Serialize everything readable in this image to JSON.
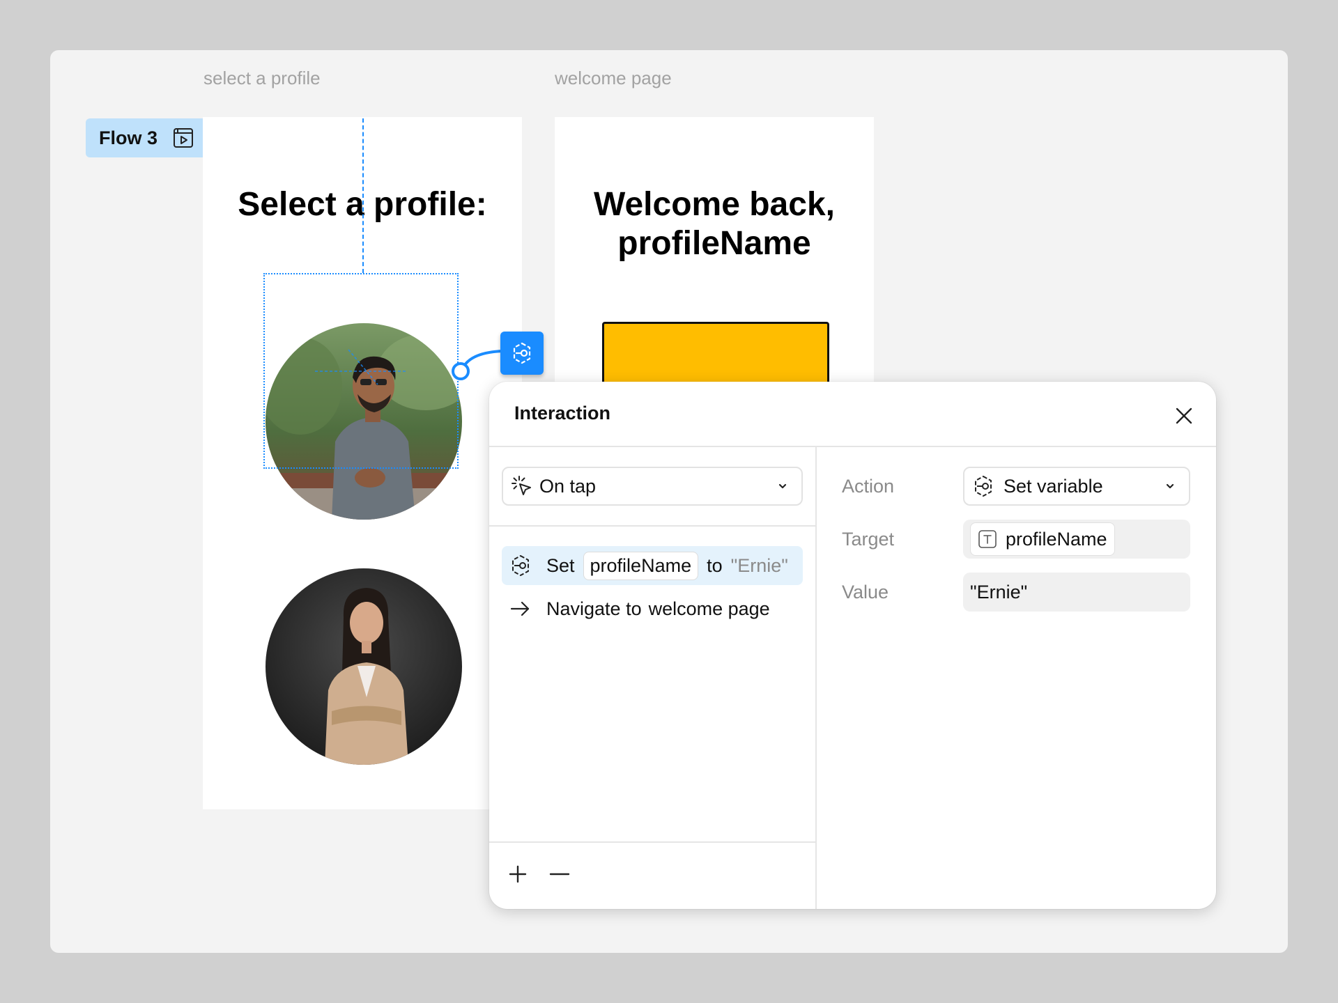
{
  "canvas": {
    "frames": [
      {
        "label": "select a profile",
        "heading": "Select a profile:"
      },
      {
        "label": "welcome page",
        "heading_line1": "Welcome back,",
        "heading_line2": "profileName"
      }
    ],
    "flow_badge": {
      "label": "Flow 3",
      "icon": "flow-play-icon"
    },
    "button_color": "#ffbd00",
    "accent_color": "#1a8cff"
  },
  "panel": {
    "title": "Interaction",
    "close_icon": "close-icon",
    "trigger": {
      "label": "On tap",
      "icon": "tap-icon"
    },
    "actions": [
      {
        "icon": "variable-icon",
        "verb": "Set",
        "variable": "profileName",
        "connector": "to",
        "value": "\"Ernie\"",
        "selected": true
      },
      {
        "icon": "arrow-right-icon",
        "verb": "Navigate to",
        "destination": "welcome page",
        "selected": false
      }
    ],
    "properties": {
      "action_label": "Action",
      "action_value": "Set variable",
      "target_label": "Target",
      "target_value": "profileName",
      "value_label": "Value",
      "value_value": "\"Ernie\""
    },
    "footer": {
      "add": "plus-icon",
      "remove": "minus-icon"
    }
  }
}
